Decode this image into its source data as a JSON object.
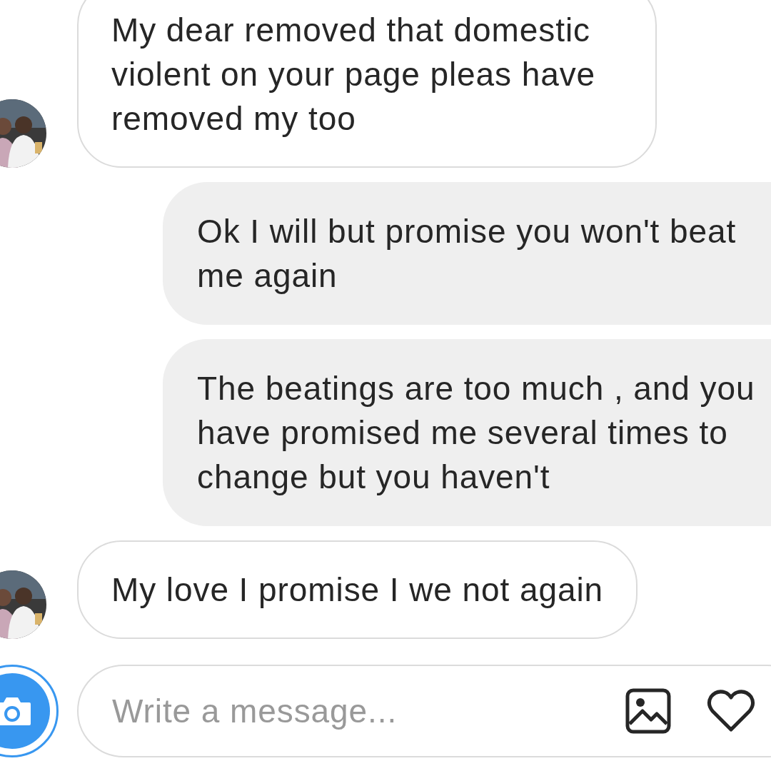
{
  "messages": [
    {
      "kind": "received",
      "text": "My dear removed that domestic violent on your page pleas have removed my too"
    },
    {
      "kind": "sent",
      "text": "Ok I will but promise you won't beat me again"
    },
    {
      "kind": "sent",
      "text": "The beatings are too much , and you have promised me several times to change but you haven't"
    },
    {
      "kind": "received",
      "text": "My love I promise I we not again"
    }
  ],
  "composer": {
    "placeholder": "Write a message..."
  }
}
